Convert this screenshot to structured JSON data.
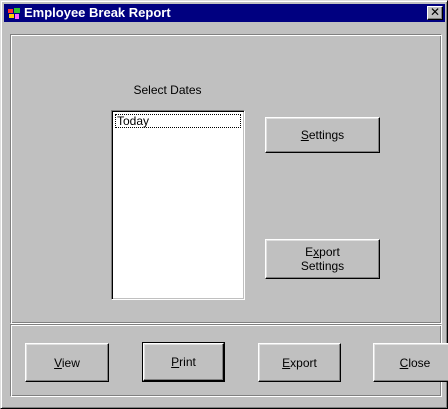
{
  "window": {
    "title": "Employee Break Report",
    "close_glyph": "✕"
  },
  "dates": {
    "label": "Select Dates",
    "items": [
      "Today"
    ]
  },
  "buttons": {
    "settings": {
      "label": "Settings",
      "mnemonic": "S"
    },
    "export_settings": {
      "line1": "Export",
      "line2": "Settings",
      "mnemonic": "x"
    },
    "view": {
      "label": "View",
      "mnemonic": "V"
    },
    "print": {
      "label": "Print",
      "mnemonic": "P"
    },
    "export": {
      "label": "Export",
      "mnemonic": "E"
    },
    "close": {
      "label": "Close",
      "mnemonic": "C"
    }
  },
  "colors": {
    "titlebar": "#000080",
    "face": "#c0c0c0"
  }
}
